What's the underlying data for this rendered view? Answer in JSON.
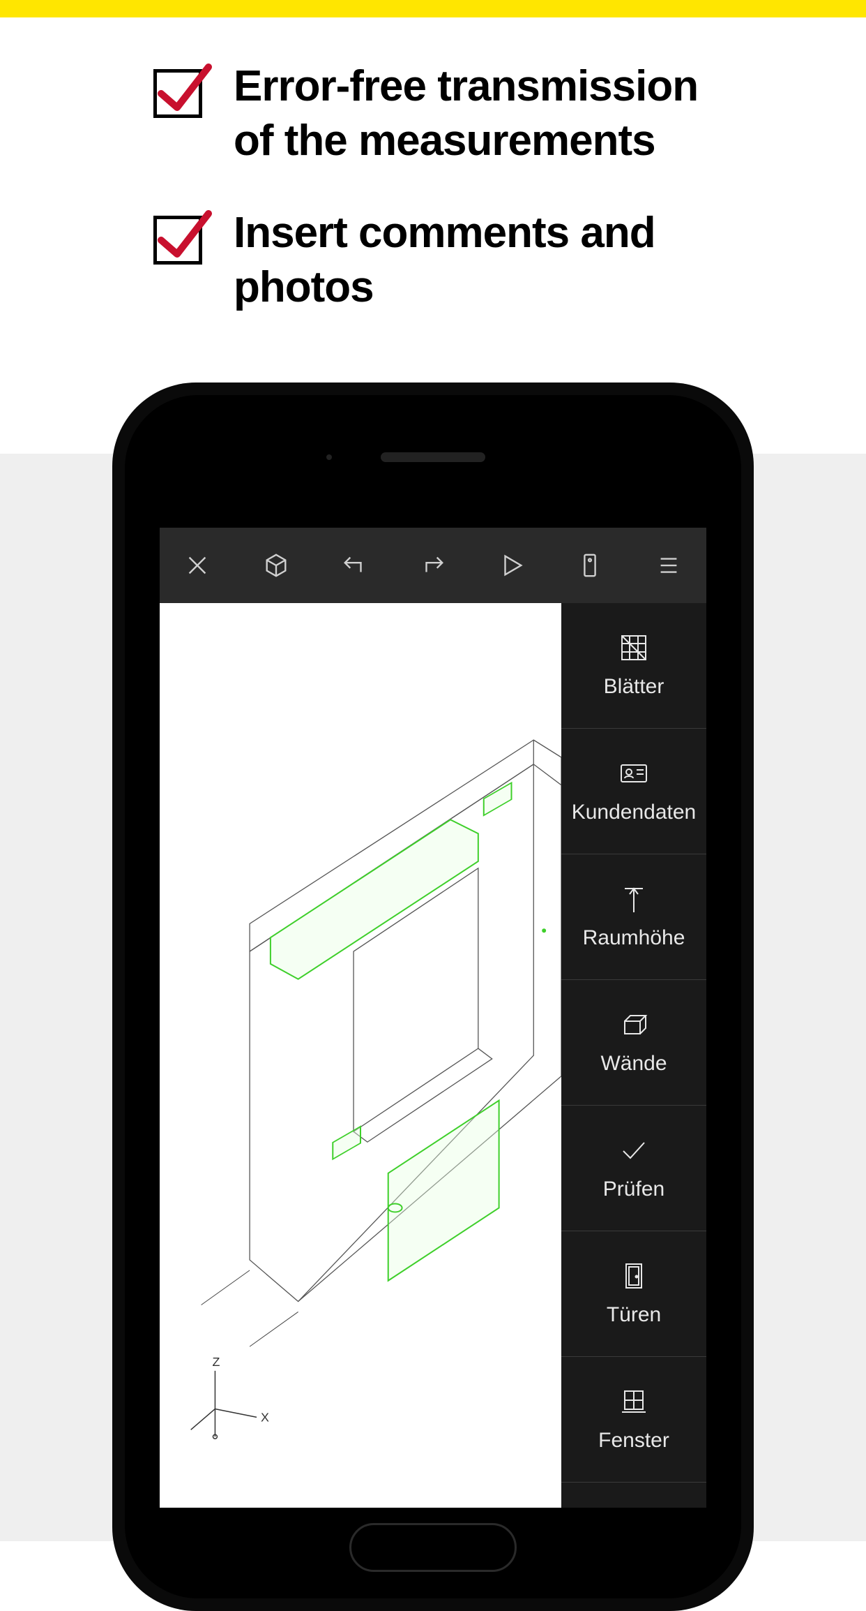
{
  "features": [
    {
      "text": "Error-free transmission of the measurements"
    },
    {
      "text": "Insert comments and photos"
    }
  ],
  "toolbar": {
    "close": "close",
    "cube": "3d-view",
    "undo": "undo",
    "redo": "redo",
    "play": "play",
    "device": "device",
    "menu": "menu"
  },
  "sidePanel": [
    {
      "id": "sheets",
      "label": "Blätter",
      "icon": "grid-x-icon"
    },
    {
      "id": "customer",
      "label": "Kundendaten",
      "icon": "id-card-icon"
    },
    {
      "id": "height",
      "label": "Raumhöhe",
      "icon": "height-icon"
    },
    {
      "id": "walls",
      "label": "Wände",
      "icon": "cube-icon"
    },
    {
      "id": "check",
      "label": "Prüfen",
      "icon": "check-icon"
    },
    {
      "id": "doors",
      "label": "Türen",
      "icon": "door-icon"
    },
    {
      "id": "windows",
      "label": "Fenster",
      "icon": "window-icon"
    }
  ],
  "axes": {
    "x": "X",
    "z": "Z"
  },
  "colors": {
    "accent": "#5fff4d",
    "check": "#c8102e",
    "yellow": "#ffe600"
  }
}
